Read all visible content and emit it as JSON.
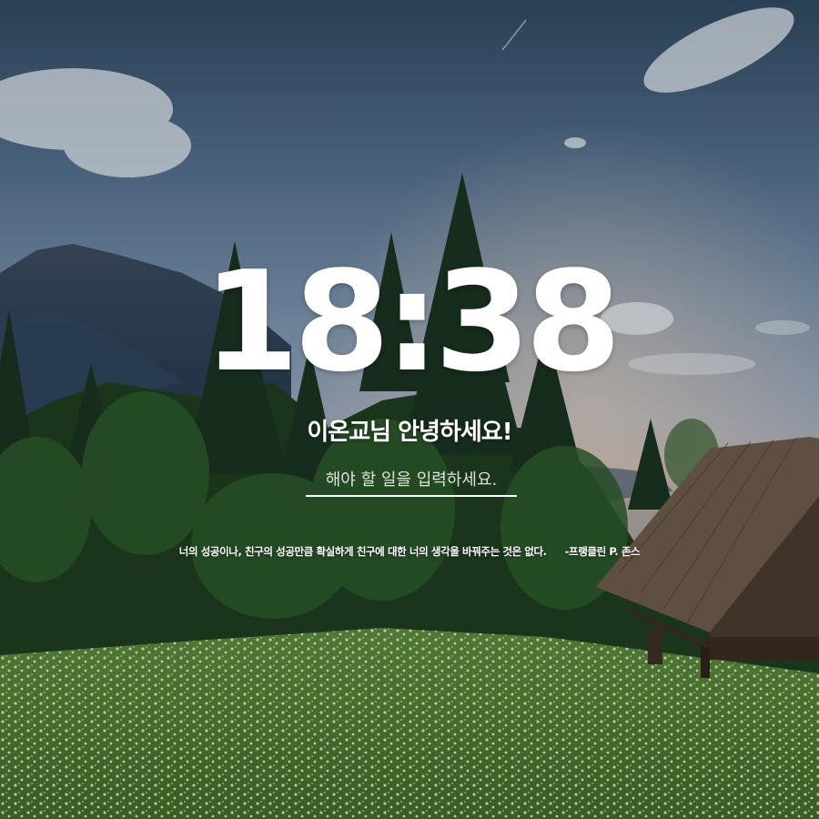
{
  "clock": {
    "time": "18:38"
  },
  "greeting": {
    "text": "이온교님 안녕하세요!"
  },
  "todo": {
    "placeholder": "해야 할 일을 입력하세요.",
    "value": ""
  },
  "quote": {
    "text": "너의 성공이나, 친구의 성공만큼 확실하게 친구에 대한 너의 생각을 바꿔주는 것은 없다.",
    "author": "-프랭클린 P. 존스"
  },
  "background": {
    "scene": "mountain meadow with pine forest, wooden hut and white wildflowers",
    "sky_color": "#4e6a88",
    "forest_color": "#1f3d22",
    "meadow_color": "#4f7a2e"
  }
}
